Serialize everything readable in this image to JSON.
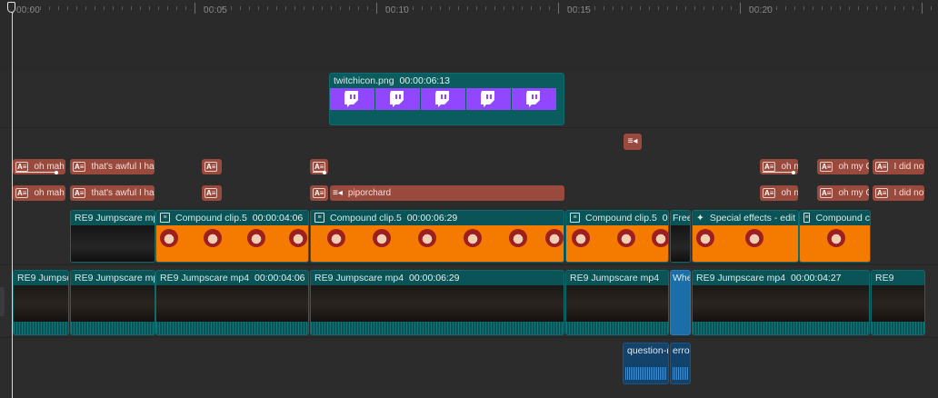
{
  "ruler": {
    "labels": [
      "00:00",
      "00:05",
      "00:10",
      "00:15",
      "00:20"
    ]
  },
  "image_track": {
    "clip": {
      "name": "twitchicon.png",
      "duration": "00:00:06:13",
      "icon": "twitch-logo-icon",
      "frame_color": "#9146ff"
    }
  },
  "marker_track": {
    "icon": "list-icon"
  },
  "title_tracks": {
    "row1": [
      {
        "icon": "A≡",
        "text": "oh mah"
      },
      {
        "icon": "A≡",
        "text": "that's awful I ha"
      },
      {
        "icon": "A≡",
        "text": ""
      },
      {
        "icon": "A≡",
        "text": ""
      },
      {
        "icon": "A≡",
        "text": "oh n"
      },
      {
        "icon": "A≡",
        "text": "oh my G"
      },
      {
        "icon": "A≡",
        "text": "I did not"
      }
    ],
    "row2": [
      {
        "icon": "A≡",
        "text": "oh mah"
      },
      {
        "icon": "A≡",
        "text": "that's awful I ha"
      },
      {
        "icon": "A≡",
        "text": ""
      },
      {
        "icon": "A≡",
        "text": ""
      },
      {
        "icon": "≡◂",
        "text": "piporchard"
      },
      {
        "icon": "A≡",
        "text": "oh n"
      },
      {
        "icon": "A≡",
        "text": "oh my G"
      },
      {
        "icon": "A≡",
        "text": "I did not"
      }
    ]
  },
  "compound_track": [
    {
      "name": "RE9 Jumpscare mp",
      "duration": ""
    },
    {
      "name": "Compound clip.5",
      "duration": "00:00:04:06"
    },
    {
      "name": "Compound clip.5",
      "duration": "00:00:06:29"
    },
    {
      "name": "Compound clip.5",
      "duration": "0"
    },
    {
      "name": "Free",
      "duration": ""
    },
    {
      "name": "Special effects - edit",
      "duration": ""
    },
    {
      "name": "Compound c",
      "duration": ""
    }
  ],
  "main_track": [
    {
      "name": "RE9 Jumpsc",
      "duration": ""
    },
    {
      "name": "RE9 Jumpscare mp4",
      "duration": ""
    },
    {
      "name": "RE9 Jumpscare mp4",
      "duration": "00:00:04:06"
    },
    {
      "name": "RE9 Jumpscare mp4",
      "duration": "00:00:06:29"
    },
    {
      "name": "RE9 Jumpscare mp4",
      "duration": ""
    },
    {
      "name": "Whe",
      "duration": ""
    },
    {
      "name": "RE9 Jumpscare mp4",
      "duration": "00:00:04:27"
    },
    {
      "name": "RE9",
      "duration": ""
    }
  ],
  "audio_track": [
    {
      "name": "question-r"
    },
    {
      "name": "erro"
    }
  ],
  "colors": {
    "background": "#2a2a2b",
    "video_clip": "#0a5356",
    "title_clip": "#9a4a3d",
    "compound_thumb": "#f57a00",
    "audio_clip": "#13426b",
    "twitch": "#9146ff"
  }
}
